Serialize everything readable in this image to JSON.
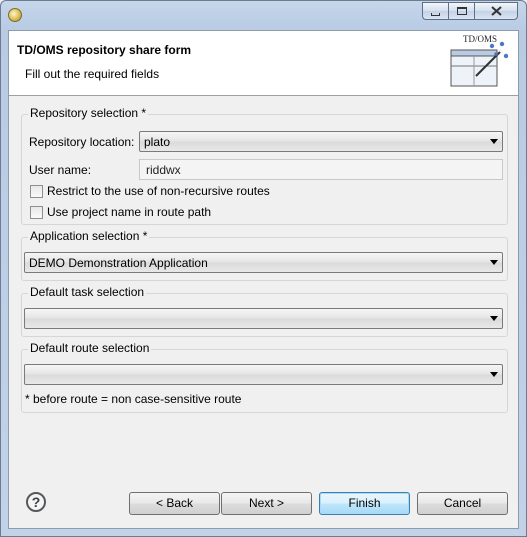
{
  "window": {
    "title": ""
  },
  "header": {
    "title": "TD/OMS repository share form",
    "subtitle": "Fill out the required fields",
    "banner_text": "TD/OMS"
  },
  "repository": {
    "group_label": "Repository selection *",
    "location_label": "Repository location:",
    "location_value": "plato",
    "user_label": "User name:",
    "user_value": "riddwx",
    "restrict_label": "Restrict to the use of non-recursive routes",
    "restrict_checked": false,
    "project_name_label": "Use project name in route path",
    "project_name_checked": false
  },
  "application": {
    "group_label": "Application selection *",
    "value": "DEMO Demonstration Application"
  },
  "task": {
    "group_label": "Default task selection",
    "value": ""
  },
  "route": {
    "group_label": "Default route selection",
    "value": "",
    "note": "* before route = non case-sensitive route"
  },
  "footer": {
    "help_glyph": "?",
    "back_label": "< Back",
    "next_label": "Next >",
    "finish_label": "Finish",
    "cancel_label": "Cancel"
  }
}
